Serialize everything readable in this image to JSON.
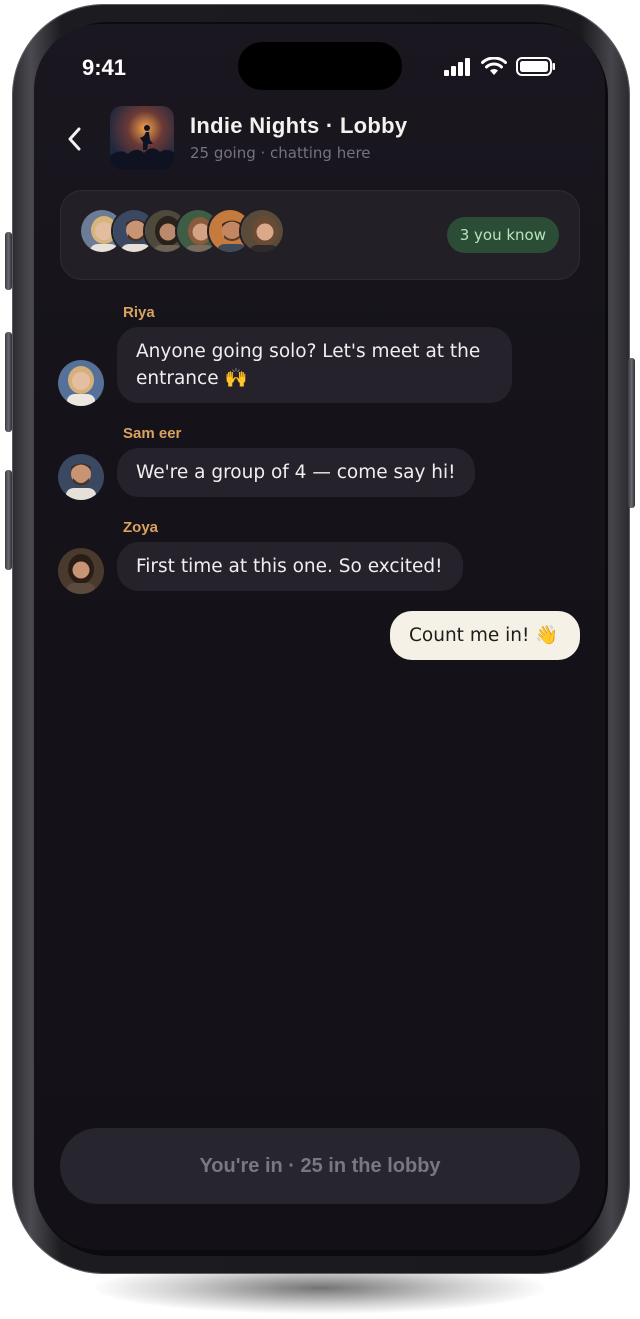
{
  "status_bar": {
    "time": "9:41"
  },
  "header": {
    "title": "Indie Nights · Lobby",
    "subtitle": "25 going · chatting here"
  },
  "friends": {
    "known_label": "3 you know",
    "avatar_count": 6
  },
  "messages": [
    {
      "sender": "Riya",
      "lines": [
        "Anyone going solo? Let's meet at the",
        "entrance 🙌"
      ]
    },
    {
      "sender": "Sam eer",
      "lines": [
        "We're a group of 4 — come say hi!"
      ]
    },
    {
      "sender": "Zoya",
      "lines": [
        "First time at this one. So excited!"
      ]
    },
    {
      "sender": "",
      "from_me": true,
      "lines": [
        "Count me in! 👋"
      ]
    }
  ],
  "cta": {
    "label": "You're in · 25 in the lobby"
  },
  "colors": {
    "background": "#151219",
    "bubble": "#25222b",
    "my_bubble": "#f5f1e6",
    "sender_name": "#d9a35f",
    "badge_bg": "#2c4d35",
    "badge_text": "#b7e3bd"
  }
}
